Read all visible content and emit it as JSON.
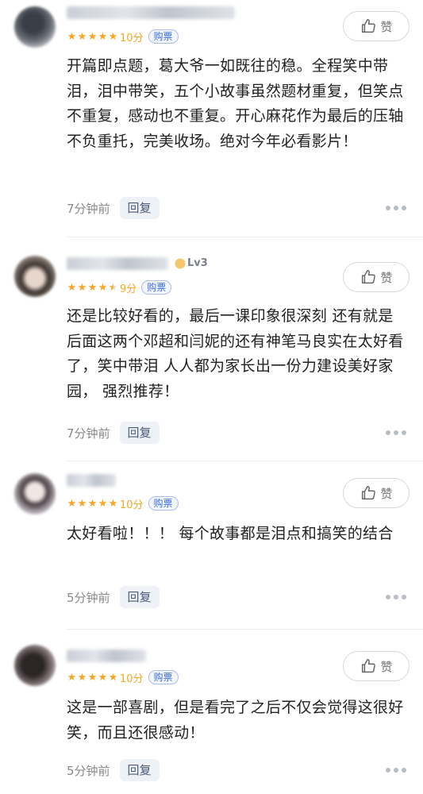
{
  "like_label": "赞",
  "reply_label": "回复",
  "ticket_label": "购票",
  "colors": {
    "star": "#f5a623",
    "ticket": "#3d6fd6",
    "reply_bg": "#eef1f5"
  },
  "comments": [
    {
      "score": "10分",
      "stars": 5,
      "text": "开篇即点题，葛大爷一如既往的稳。全程笑中带泪，泪中带笑，五个小故事虽然题材重复，但笑点不重复，感动也不重复。开心麻花作为最后的压轴不负重托，完美收场。绝对今年必看影片！",
      "time": "7分钟前"
    },
    {
      "score": "9分",
      "stars": 4.5,
      "level": "Lv3",
      "text": "还是比较好看的，最后一课印象很深刻 还有就是后面这两个邓超和闫妮的还有神笔马良实在太好看了，笑中带泪 人人都为家长出一份力建设美好家园， 强烈推荐！",
      "time": "7分钟前"
    },
    {
      "score": "10分",
      "stars": 5,
      "text": "太好看啦！！！ 每个故事都是泪点和搞笑的结合",
      "time": "5分钟前"
    },
    {
      "score": "10分",
      "stars": 5,
      "text": "这是一部喜剧，但是看完了之后不仅会觉得这很好笑，而且还很感动！",
      "time": "5分钟前"
    }
  ]
}
